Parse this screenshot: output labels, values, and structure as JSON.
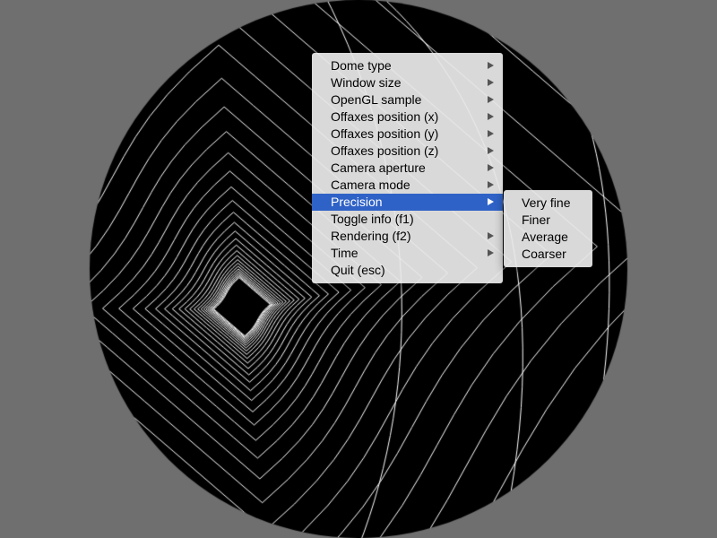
{
  "colors": {
    "page_background": "#6f6f6f",
    "dome_background": "#000000",
    "dome_lines": "#ffffff",
    "menu_background": "#ececec",
    "menu_highlight": "#2f62c6"
  },
  "main_menu": {
    "items": [
      {
        "label": "Dome type",
        "has_submenu": true
      },
      {
        "label": "Window size",
        "has_submenu": true
      },
      {
        "label": "OpenGL sample",
        "has_submenu": true
      },
      {
        "label": "Offaxes position (x)",
        "has_submenu": true
      },
      {
        "label": "Offaxes position (y)",
        "has_submenu": true
      },
      {
        "label": "Offaxes position (z)",
        "has_submenu": true
      },
      {
        "label": "Camera aperture",
        "has_submenu": true
      },
      {
        "label": "Camera mode",
        "has_submenu": true
      },
      {
        "label": "Precision",
        "has_submenu": true,
        "selected": true
      },
      {
        "label": "Toggle info (f1)",
        "has_submenu": false
      },
      {
        "label": "Rendering (f2)",
        "has_submenu": true
      },
      {
        "label": "Time",
        "has_submenu": true
      },
      {
        "label": "Quit (esc)",
        "has_submenu": false
      }
    ]
  },
  "precision_submenu": {
    "items": [
      {
        "label": "Very fine"
      },
      {
        "label": "Finer"
      },
      {
        "label": "Average"
      },
      {
        "label": "Coarser"
      }
    ]
  }
}
